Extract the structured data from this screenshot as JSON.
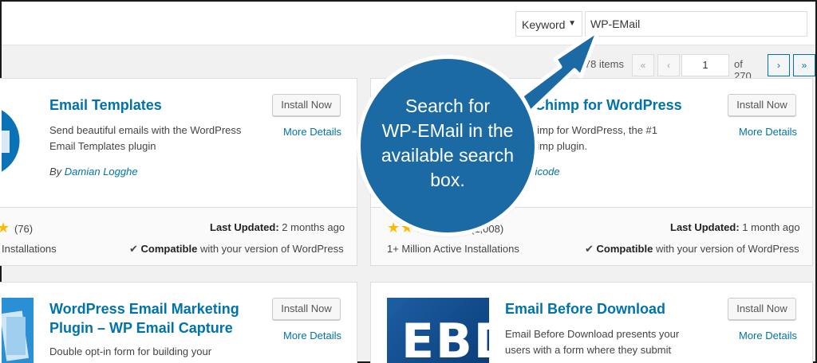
{
  "search": {
    "type_label": "Keyword",
    "value": "WP-EMail"
  },
  "pagination": {
    "items_text": "078 items",
    "first": "«",
    "prev": "‹",
    "current_page": "1",
    "of_text": "of 270",
    "next": "›",
    "last": "»"
  },
  "cards": [
    {
      "title": "Email Templates",
      "desc_line1": "Send beautiful emails with the WordPress",
      "desc_line2": "Email Templates plugin",
      "author_prefix": "By ",
      "author": "Damian Logghe",
      "install_label": "Install Now",
      "more_label": "More Details",
      "stars": "★",
      "rating_count": "(76)",
      "last_updated_label": "Last Updated:",
      "last_updated_value": "2 months ago",
      "installs": "Installations",
      "compat_bold": "Compatible",
      "compat_rest": "with your version of WordPress"
    },
    {
      "title": "ilChimp for WordPress",
      "desc_line1": "himp for WordPress, the #1",
      "desc_line2": "himp plugin.",
      "author": "ericode",
      "install_label": "Install Now",
      "more_label": "More Details",
      "stars": "★★★★★",
      "rating_count": "(1,008)",
      "last_updated_label": "Last Updated:",
      "last_updated_value": "1 month ago",
      "installs": "1+ Million Active Installations",
      "compat_bold": "Compatible",
      "compat_rest": "with your version of WordPress"
    },
    {
      "title_line1": "WordPress Email Marketing",
      "title_line2": "Plugin – WP Email Capture",
      "desc_line1": "Double opt-in form for building your",
      "install_label": "Install Now",
      "more_label": "More Details"
    },
    {
      "title": "Email Before Download",
      "icon_text": "EBD",
      "desc_line1": "Email Before Download presents your",
      "desc_line2": "users with a form where they submit",
      "install_label": "Install Now",
      "more_label": "More Details"
    }
  ],
  "callout": {
    "line1": "Search for",
    "line2": "WP-EMail in the",
    "line3": "available search",
    "line4": "box."
  },
  "colors": {
    "accent": "#0073aa",
    "callout": "#1c6aa3",
    "stars": "#ffb900"
  }
}
